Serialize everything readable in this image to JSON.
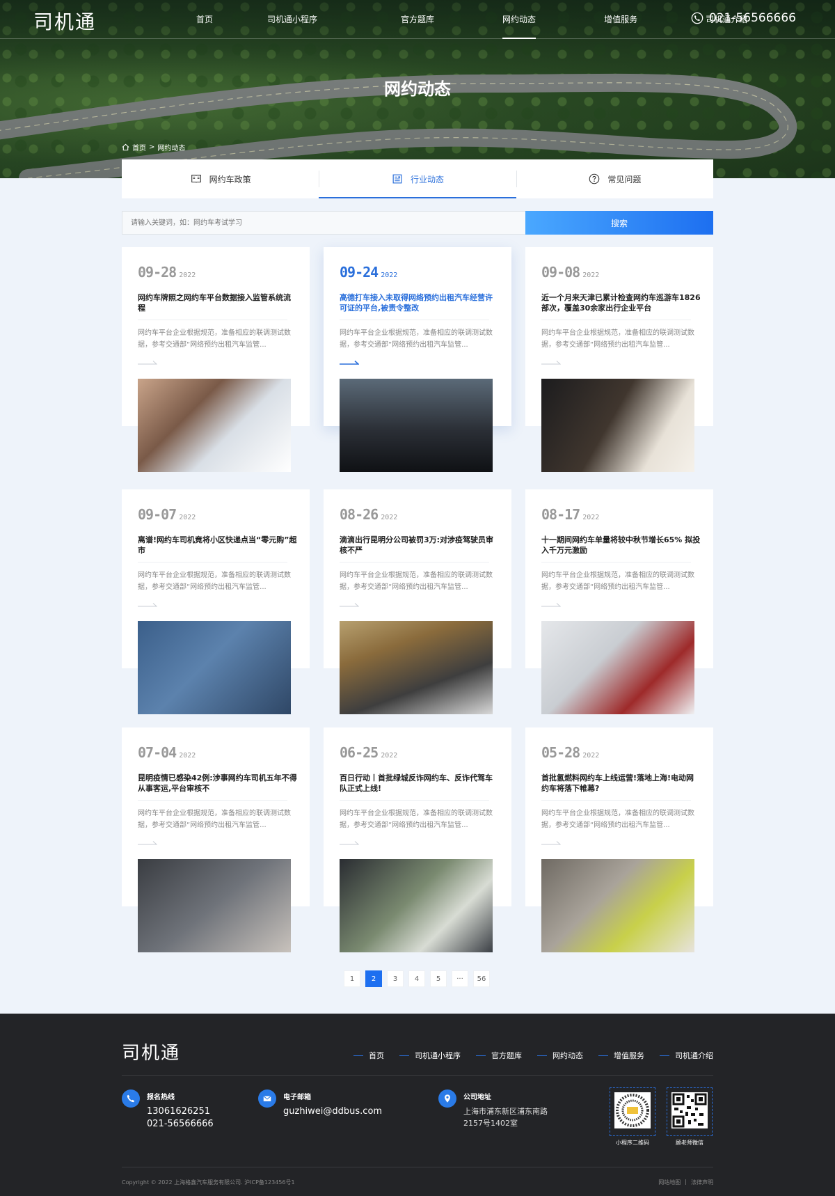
{
  "brand": {
    "logo": "司机通"
  },
  "nav": [
    "首页",
    "司机通小程序",
    "官方题库",
    "网约动态",
    "增值服务",
    "司机通介绍"
  ],
  "nav_active_index": 3,
  "phone": "021-56566666",
  "hero": {
    "title": "网约动态"
  },
  "breadcrumb": {
    "home": "首页",
    "sep": ">",
    "current": "网约动态"
  },
  "tabs": [
    {
      "label": "网约车政策",
      "icon": "policy-book-icon"
    },
    {
      "label": "行业动态",
      "icon": "news-list-icon"
    },
    {
      "label": "常见问题",
      "icon": "question-circle-icon"
    }
  ],
  "tabs_active_index": 1,
  "search": {
    "placeholder": "请输入关键词，如：网约车考试学习",
    "button": "搜索"
  },
  "articles": [
    {
      "date": "09-28",
      "year": "2022",
      "title": "网约车牌照之网约车平台数据接入监管系统流程",
      "desc": "网约车平台企业根据规范，准备相应的联调测试数据，参考交通部“网络预约出租汽车监管...",
      "image": "phone-payment-photo"
    },
    {
      "date": "09-24",
      "year": "2022",
      "title": "高德打车接入未取得网络预约出租汽车经营许可证的平台,被责令整改",
      "desc": "网约车平台企业根据规范，准备相应的联调测试数据，参考交通部“网络预约出租汽车监管...",
      "image": "dashboard-phone-photo"
    },
    {
      "date": "09-08",
      "year": "2022",
      "title": "近一个月来天津已累计检查网约车巡游车1826部次，覆盖30余家出行企业平台",
      "desc": "网约车平台企业根据规范，准备相应的联调测试数据，参考交通部“网络预约出租汽车监管...",
      "image": "car-door-photo"
    },
    {
      "date": "09-07",
      "year": "2022",
      "title": "离谱!网约车司机竟将小区快递点当“零元购”超市",
      "desc": "网约车平台企业根据规范，准备相应的联调测试数据，参考交通部“网络预约出租汽车监管...",
      "image": "denim-phone-photo"
    },
    {
      "date": "08-26",
      "year": "2022",
      "title": "滴滴出行昆明分公司被罚3万:对涉疫驾驶员审核不严",
      "desc": "网约车平台企业根据规范，准备相应的联调测试数据，参考交通部“网络预约出租汽车监管...",
      "image": "roadside-car-photo"
    },
    {
      "date": "08-17",
      "year": "2022",
      "title": "十一期间网约车单量将较中秋节增长65% 拟投入千万元激励",
      "desc": "网约车平台企业根据规范，准备相应的联调测试数据，参考交通部“网络预约出租汽车监管...",
      "image": "happy-couple-car-photo"
    },
    {
      "date": "07-04",
      "year": "2022",
      "title": "昆明疫情已感染42例:涉事网约车司机五年不得从事客运,平台审核不",
      "desc": "网约车平台企业根据规范，准备相应的联调测试数据，参考交通部“网络预约出租汽车监管...",
      "image": "seatbelt-photo"
    },
    {
      "date": "06-25",
      "year": "2022",
      "title": "百日行动丨首批绿城反诈网约车、反诈代驾车队正式上线!",
      "desc": "网约车平台企业根据规范，准备相应的联调测试数据，参考交通部“网络预约出租汽车监管...",
      "image": "navigation-screen-photo"
    },
    {
      "date": "05-28",
      "year": "2022",
      "title": "首批氢燃料网约车上线运营!落地上海!电动网约车将落下帷幕?",
      "desc": "网约车平台企业根据规范，准备相应的联调测试数据，参考交通部“网络预约出租汽车监管...",
      "image": "taxi-street-photo"
    }
  ],
  "active_article_index": 1,
  "pagination": [
    "1",
    "2",
    "3",
    "4",
    "5",
    "···",
    "56"
  ],
  "pagination_active": "2",
  "footer": {
    "logo": "司机通",
    "nav": [
      "首页",
      "司机通小程序",
      "官方题库",
      "网约动态",
      "增值服务",
      "司机通介绍"
    ],
    "hotline": {
      "label": "报名热线",
      "values": [
        "13061626251",
        "021-56566666"
      ]
    },
    "email": {
      "label": "电子邮箱",
      "value": "guzhiwei@ddbus.com"
    },
    "address": {
      "label": "公司地址",
      "lines": [
        "上海市浦东新区浦东南路",
        "2157号1402室"
      ]
    },
    "qr": [
      {
        "caption": "小程序二维码"
      },
      {
        "caption": "顾老师微信"
      }
    ],
    "copyright": "Copyright © 2022 上海格鑫汽车服务有限公司. 沪ICP备123456号1",
    "links": [
      "网站地图",
      "|",
      "法律声明"
    ]
  },
  "colors": {
    "accent": "#1d6ff0",
    "footer_bg": "#232427",
    "page_bg": "#eef3fa"
  }
}
